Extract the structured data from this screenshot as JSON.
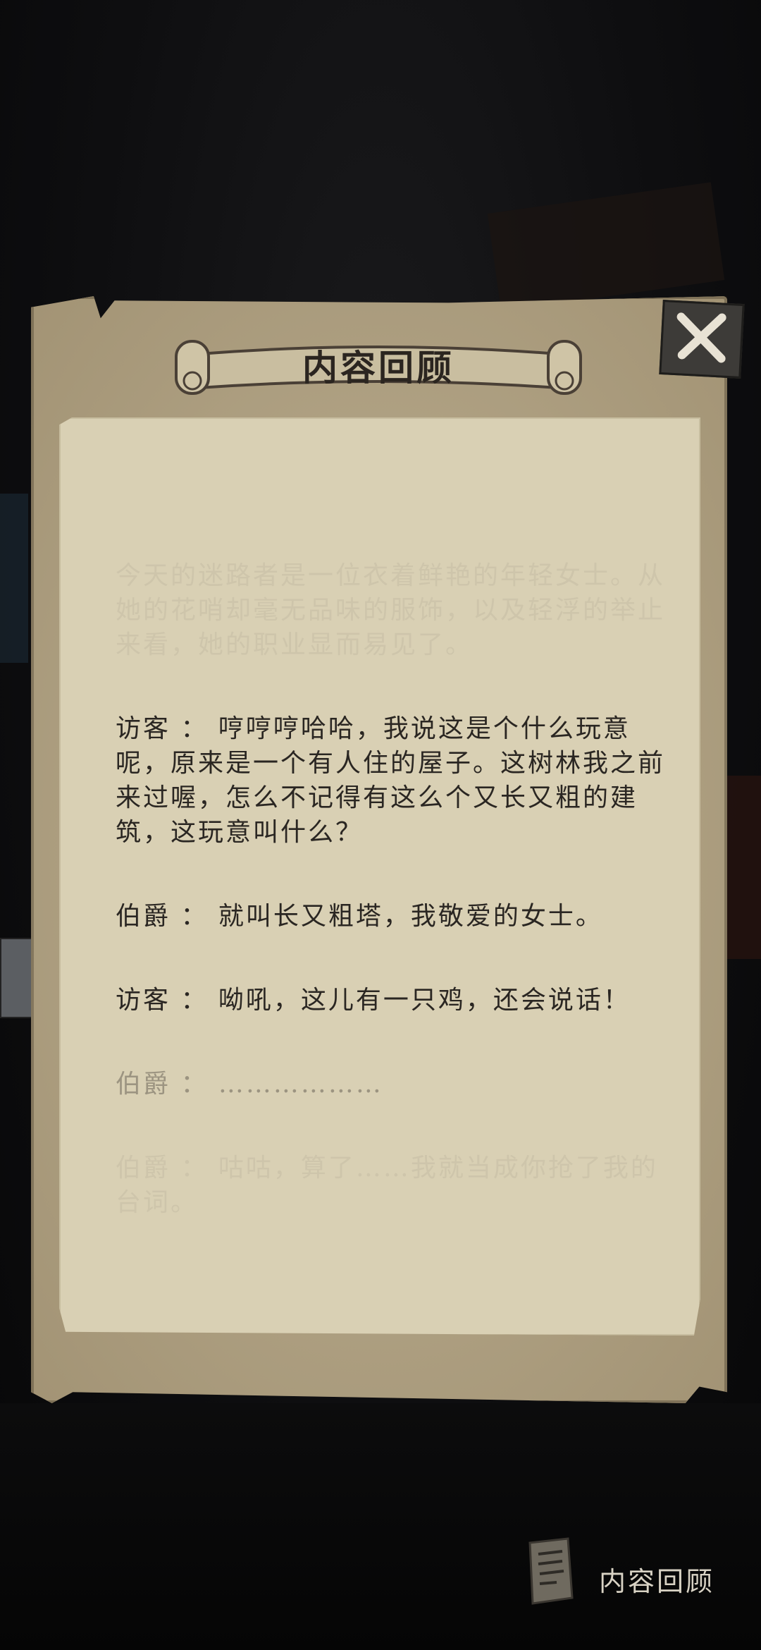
{
  "dialog": {
    "title": "内容回顾",
    "close_icon": "close-x-icon",
    "entries": [
      {
        "style": "faded",
        "text": "今天的迷路者是一位衣着鲜艳的年轻女士。从她的花哨却毫无品味的服饰，以及轻浮的举止来看，她的职业显而易见了。"
      },
      {
        "style": "normal",
        "speaker": "访客 ：",
        "text": "哼哼哼哈哈，我说这是个什么玩意呢，原来是一个有人住的屋子。这树林我之前来过喔，怎么不记得有这么个又长又粗的建筑，这玩意叫什么？"
      },
      {
        "style": "normal",
        "speaker": "伯爵 ：",
        "text": "就叫长又粗塔，我敬爱的女士。"
      },
      {
        "style": "normal",
        "speaker": "访客 ：",
        "text": "呦吼，这儿有一只鸡，还会说话！"
      },
      {
        "style": "dim",
        "speaker": "伯爵 ：",
        "text": "………………"
      },
      {
        "style": "faded",
        "speaker": "伯爵 ：",
        "text": "咕咕，算了……我就当成你抢了我的台词。"
      }
    ]
  },
  "bottom_button": {
    "label": "内容回顾",
    "icon": "scroll-document-icon"
  }
}
